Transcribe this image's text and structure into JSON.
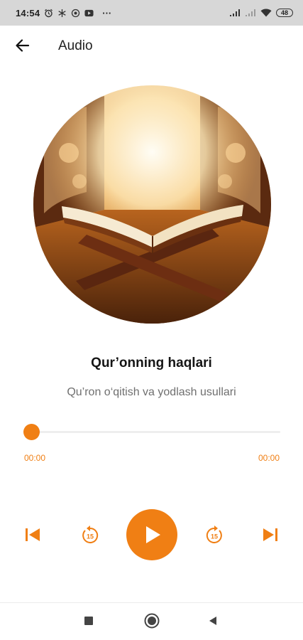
{
  "status_bar": {
    "time": "14:54",
    "notification_icons": [
      "alarm-icon",
      "snowflake-icon",
      "circle-app-icon",
      "youtube-icon"
    ],
    "more": "···",
    "battery": "48"
  },
  "app_bar": {
    "title": "Audio"
  },
  "track": {
    "title": "Qur’onning haqlari",
    "subtitle": "Qu’ron o‘qitish va yodlash usullari",
    "progress": 0,
    "current_time": "00:00",
    "total_time": "00:00"
  },
  "controls": {
    "rewind_seconds": "15",
    "forward_seconds": "15"
  },
  "colors": {
    "accent": "#f07f14",
    "text_primary": "#151515",
    "text_secondary": "#6f6f6f"
  }
}
